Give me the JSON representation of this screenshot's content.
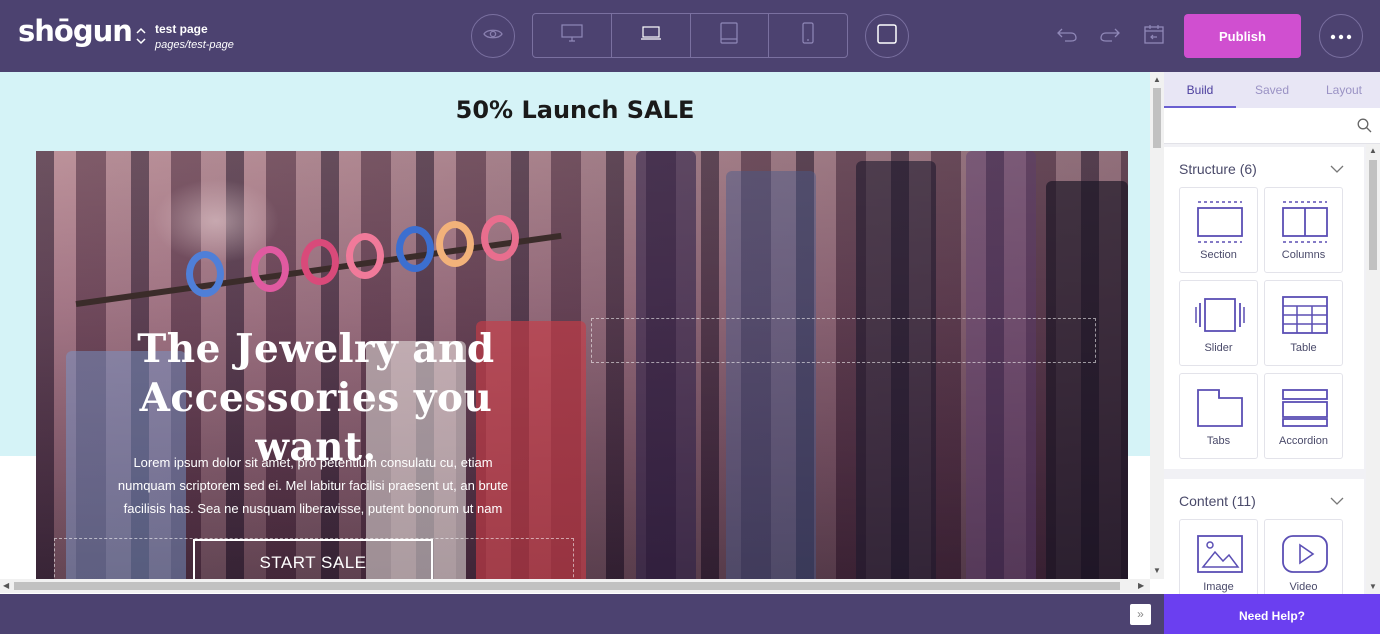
{
  "app": {
    "logo": "shōgun",
    "page_name": "test page",
    "page_path": "pages/test-page",
    "publish_label": "Publish",
    "accent": "#4c4270",
    "publish_color": "#d04fd0"
  },
  "toolbar": {
    "preview_icon": "eye-icon",
    "devices": [
      "desktop-icon",
      "laptop-icon",
      "tablet-icon",
      "mobile-icon"
    ],
    "frame_icon": "frame-icon",
    "undo_icon": "undo-icon",
    "redo_icon": "redo-icon",
    "history_icon": "history-icon",
    "more_icon": "more-icon"
  },
  "canvas": {
    "sale_title": "50% Launch SALE",
    "hero_heading_line1": "The Jewelry and",
    "hero_heading_line2": "Accessories you want.",
    "hero_body_line1": "Lorem ipsum dolor sit amet, pro petentium consulatu cu, etiam",
    "hero_body_line2": "numquam scriptorem sed ei. Mel labitur facilisi praesent ut, an brute",
    "hero_body_line3": "facilisis has. Sea ne nusquam liberavisse, putent bonorum ut nam",
    "cta_label": "START SALE",
    "band_color": "#d5f3f7"
  },
  "panel": {
    "tabs": [
      "Build",
      "Saved",
      "Layout"
    ],
    "active_tab": "Build",
    "search_placeholder": "",
    "structure_title": "Structure (6)",
    "structure_items": [
      "Section",
      "Columns",
      "Slider",
      "Table",
      "Tabs",
      "Accordion"
    ],
    "content_title": "Content (11)",
    "content_items": [
      "Image",
      "Video"
    ]
  },
  "footer": {
    "collapse_label": "»",
    "help_label": "Need Help?",
    "help_color": "#6b3ff0"
  }
}
